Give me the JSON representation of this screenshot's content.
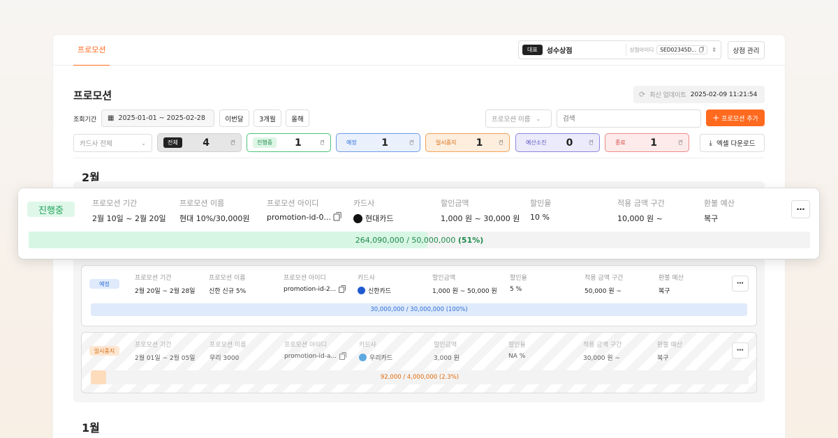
{
  "nav": {
    "tab": "프로모션"
  },
  "store": {
    "rep": "대표",
    "name": "성수상점",
    "id_label": "상점아이디",
    "id_value": "SED02345D...",
    "manage": "상점 관리"
  },
  "page": {
    "title": "프로모션",
    "update_label": "최신 업데이트",
    "update_time": "2025-02-09 11:21:54"
  },
  "filters": {
    "period_label": "조회기간",
    "date_range": "2025-01-01 ~ 2025-02-28",
    "this_month": "이번달",
    "three_months": "3개월",
    "this_year": "올해",
    "field_select": "프로모션 이름",
    "search_placeholder": "검색",
    "add": "프로모션 추가",
    "card_select": "카드사 전체",
    "excel": "엑셀 다운로드"
  },
  "chips": [
    {
      "label": "전체",
      "count": "4",
      "unit": "건"
    },
    {
      "label": "진행중",
      "count": "1",
      "unit": "건"
    },
    {
      "label": "예정",
      "count": "1",
      "unit": "건"
    },
    {
      "label": "일시중지",
      "count": "1",
      "unit": "건"
    },
    {
      "label": "예산소진",
      "count": "0",
      "unit": "건"
    },
    {
      "label": "종료",
      "count": "1",
      "unit": "건"
    }
  ],
  "months": {
    "feb": "2월",
    "jan": "1월"
  },
  "headers": {
    "period": "프로모션 기간",
    "name": "프로모션 이름",
    "id": "프로모션 아이디",
    "card": "카드사",
    "amount": "할인금액",
    "rate": "할인율",
    "range": "적용 금액 구간",
    "refund": "환불 예산"
  },
  "promos": [
    {
      "status": "진행중",
      "period": "2월 10일 ~ 2월 20일",
      "name": "현대 10%/30,000원",
      "id": "promotion-id-0...",
      "card": "현대카드",
      "amount": "1,000 원 ~ 30,000 원",
      "rate": "10 %",
      "range": "10,000 원 ~",
      "refund": "복구",
      "budget": "264,090,000 / 50,000,000",
      "pct": "(51%)",
      "progress": 0.51,
      "color": "#22a35a",
      "bg": "#dff7e8",
      "logo": "#111111"
    },
    {
      "status": "예정",
      "period": "2월 20일 ~ 2월 28일",
      "name": "신한 신규 5%",
      "id": "promotion-id-2...",
      "card": "신한카드",
      "amount": "1,000 원 ~ 50,000 원",
      "rate": "5 %",
      "range": "50,000 원 ~",
      "refund": "복구",
      "budget": "30,000,000 / 30,000,000",
      "pct": "(100%)",
      "progress": 1.0,
      "color": "#2f6fd6",
      "bg": "#dfeafb",
      "logo": "#1f5ad1"
    },
    {
      "status": "일시중지",
      "period": "2월 01일 ~ 2월 05일",
      "name": "우리 3000",
      "id": "promotion-id-a...",
      "card": "우리카드",
      "amount": "3,000 원",
      "rate": "NA %",
      "range": "30,000 원 ~",
      "refund": "복구",
      "budget": "92,000 / 4,000,000",
      "pct": "(2.3%)",
      "progress": 0.023,
      "color": "#e07a1a",
      "bg": "#fde7d2",
      "logo": "#2a8fd8"
    }
  ]
}
